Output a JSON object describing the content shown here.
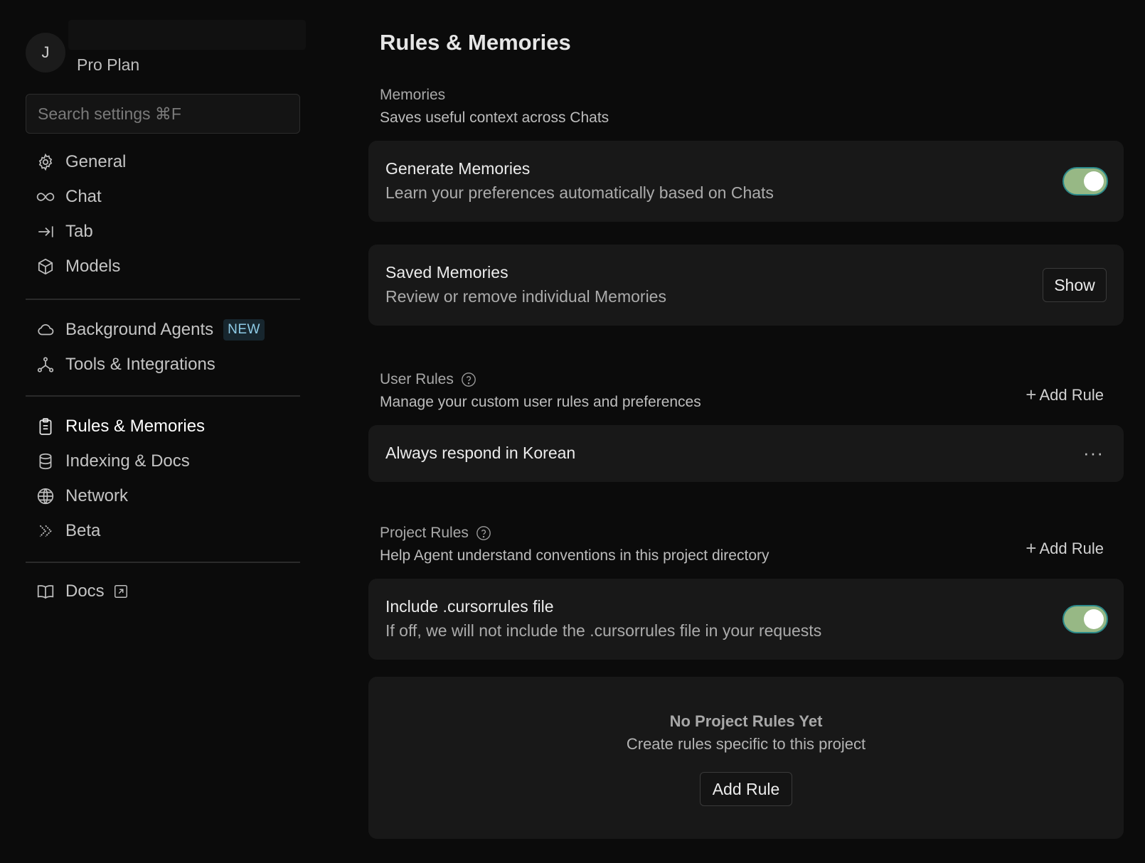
{
  "sidebar": {
    "avatar_initial": "J",
    "plan": "Pro Plan",
    "search_placeholder": "Search settings ⌘F",
    "items": [
      {
        "label": "General",
        "icon": "gear-icon"
      },
      {
        "label": "Chat",
        "icon": "infinity-icon"
      },
      {
        "label": "Tab",
        "icon": "tab-arrow-icon"
      },
      {
        "label": "Models",
        "icon": "cube-icon"
      },
      {
        "label": "Background Agents",
        "icon": "cloud-icon",
        "badge": "NEW"
      },
      {
        "label": "Tools & Integrations",
        "icon": "nodes-icon"
      },
      {
        "label": "Rules & Memories",
        "icon": "clipboard-icon",
        "active": true
      },
      {
        "label": "Indexing & Docs",
        "icon": "database-icon"
      },
      {
        "label": "Network",
        "icon": "globe-icon"
      },
      {
        "label": "Beta",
        "icon": "chevrons-icon"
      },
      {
        "label": "Docs",
        "icon": "book-icon",
        "external": true
      }
    ]
  },
  "main": {
    "title": "Rules & Memories",
    "memories": {
      "title": "Memories",
      "description": "Saves useful context across Chats",
      "generate": {
        "title": "Generate Memories",
        "description": "Learn your preferences automatically based on Chats",
        "enabled": true
      },
      "saved": {
        "title": "Saved Memories",
        "description": "Review or remove individual Memories",
        "button": "Show"
      }
    },
    "user_rules": {
      "title": "User Rules",
      "description": "Manage your custom user rules and preferences",
      "add_label": "Add Rule",
      "rules": [
        "Always respond in Korean"
      ],
      "menu_label": "···"
    },
    "project_rules": {
      "title": "Project Rules",
      "description": "Help Agent understand conventions in this project directory",
      "add_label": "Add Rule",
      "cursorrules": {
        "title": "Include .cursorrules file",
        "description": "If off, we will not include the .cursorrules file in your requests",
        "enabled": true
      },
      "empty": {
        "title": "No Project Rules Yet",
        "description": "Create rules specific to this project",
        "button": "Add Rule"
      }
    }
  },
  "colors": {
    "background": "#0b0b0b",
    "card": "#181818",
    "toggle_on": "#97b885",
    "badge_text": "#8ecbe6"
  }
}
